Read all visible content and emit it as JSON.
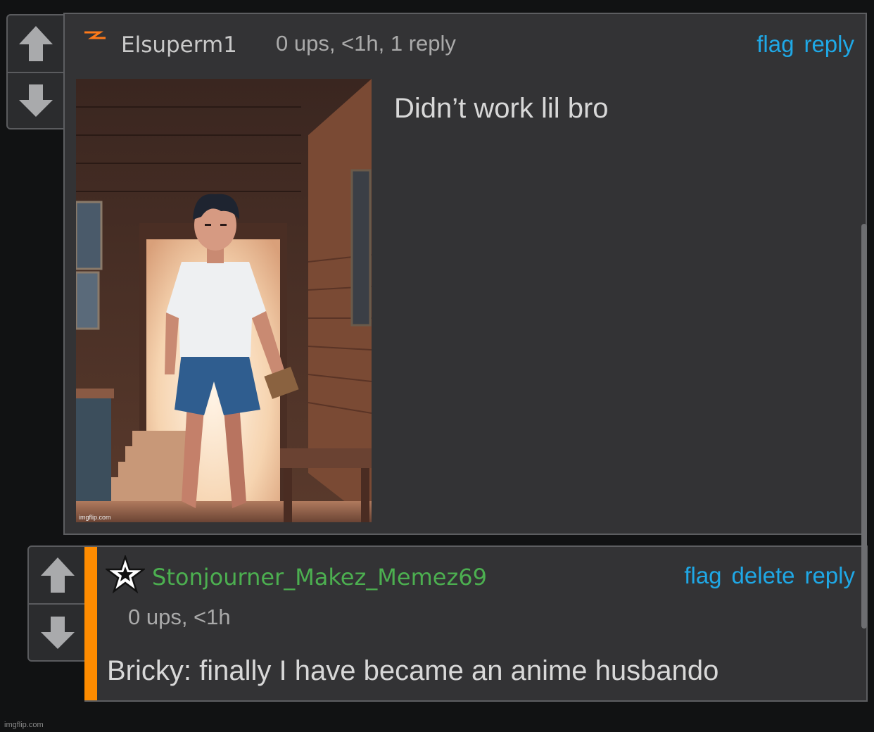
{
  "comments": [
    {
      "username": "Elsuperm1",
      "meta": "0 ups, <1h, 1 reply",
      "actions": [
        "flag",
        "reply"
      ],
      "text": "Didn’t work lil bro",
      "image_watermark": "imgflip.com"
    },
    {
      "username": "Stonjourner_Makez_Memez69",
      "meta": "0 ups, <1h",
      "actions": [
        "flag",
        "delete",
        "reply"
      ],
      "text": "Bricky: finally I have became an anime husbando"
    }
  ],
  "footer": {
    "watermark": "imgflip.com"
  },
  "colors": {
    "background": "#111213",
    "panel": "#333335",
    "link": "#1fa8e6",
    "username_green": "#4caf50",
    "accent_orange": "#ff8c00"
  }
}
